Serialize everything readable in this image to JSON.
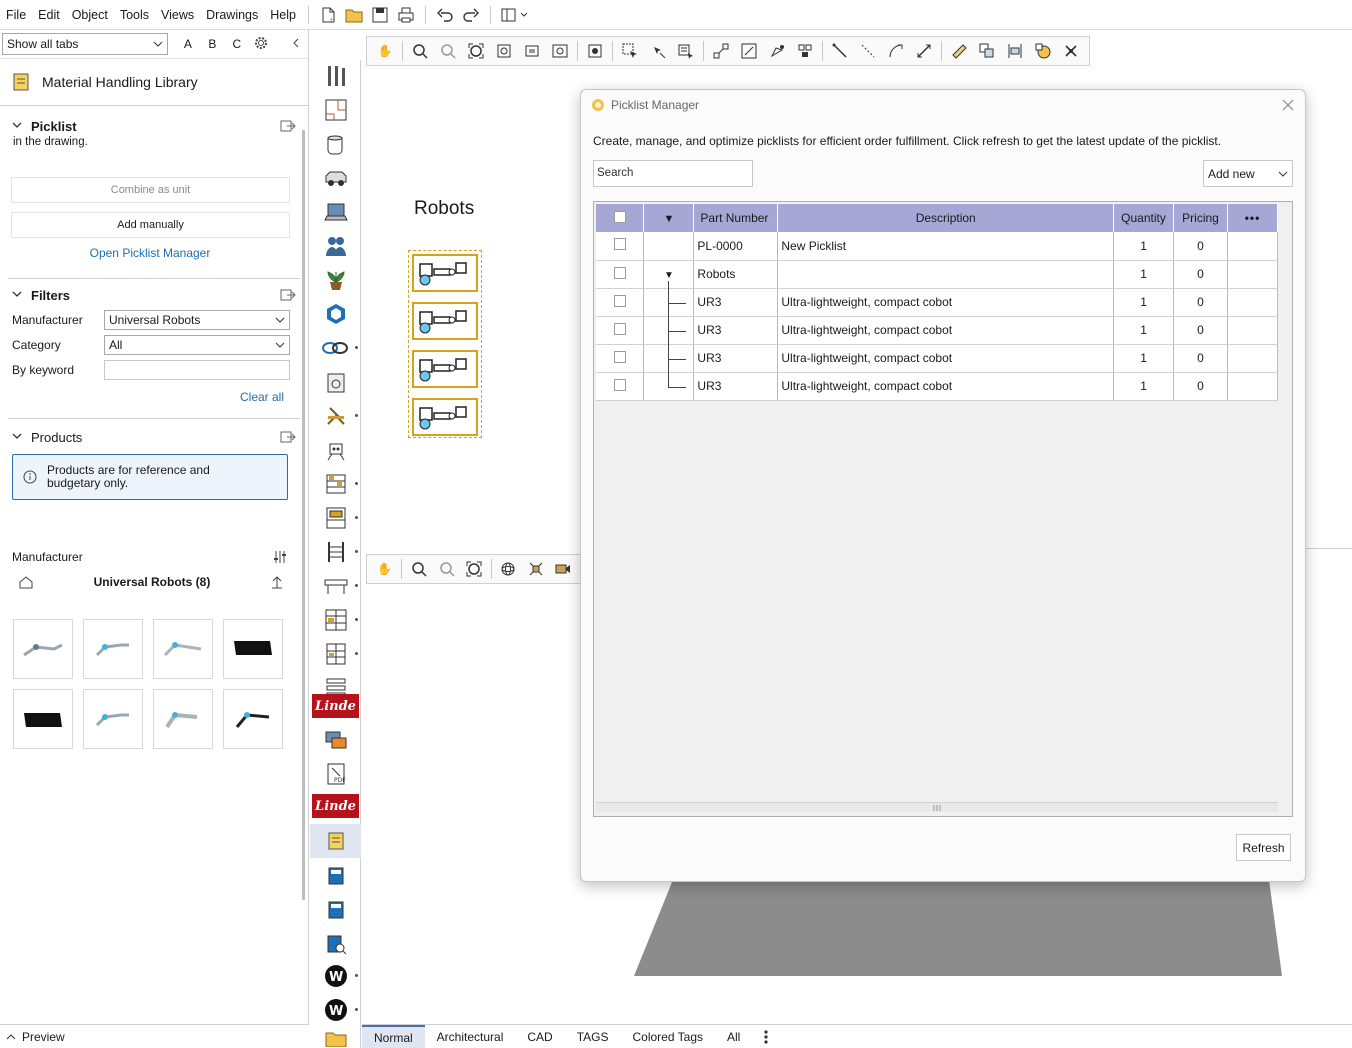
{
  "menu": [
    "File",
    "Edit",
    "Object",
    "Tools",
    "Views",
    "Drawings",
    "Help"
  ],
  "left": {
    "tab_select": "Show all tabs",
    "abc": [
      "A",
      "B",
      "C"
    ],
    "library_title": "Material Handling Library",
    "picklist": {
      "header": "Picklist",
      "note": "in the drawing.",
      "combine": "Combine as unit",
      "add_manual": "Add manually",
      "open_manager": "Open Picklist Manager"
    },
    "filters": {
      "header": "Filters",
      "manufacturer_label": "Manufacturer",
      "manufacturer_value": "Universal Robots",
      "category_label": "Category",
      "category_value": "All",
      "keyword_label": "By keyword",
      "clear": "Clear all"
    },
    "products": {
      "header": "Products",
      "info": "Products are for reference and budgetary only.",
      "manufacturer_label": "Manufacturer",
      "group_title": "Universal Robots (8)"
    },
    "preview": "Preview"
  },
  "canvas": {
    "robots_label": "Robots"
  },
  "strip": {
    "linde": "Linde"
  },
  "bottom_tabs": [
    "Normal",
    "Architectural",
    "CAD",
    "TAGS",
    "Colored Tags",
    "All"
  ],
  "dialog": {
    "title": "Picklist Manager",
    "description": "Create, manage, and optimize picklists for efficient order fulfillment. Click refresh to get the latest update of the picklist.",
    "search_placeholder": "Search",
    "add_new": "Add new",
    "columns": [
      "Part Number",
      "Description",
      "Quantity",
      "Pricing"
    ],
    "rows": [
      {
        "part": "PL-0000",
        "desc": "New Picklist",
        "qty": "1",
        "price": "0"
      },
      {
        "part": "Robots",
        "desc": "",
        "qty": "1",
        "price": "0"
      },
      {
        "part": "UR3",
        "desc": "Ultra-lightweight, compact cobot",
        "qty": "1",
        "price": "0"
      },
      {
        "part": "UR3",
        "desc": "Ultra-lightweight, compact cobot",
        "qty": "1",
        "price": "0"
      },
      {
        "part": "UR3",
        "desc": "Ultra-lightweight, compact cobot",
        "qty": "1",
        "price": "0"
      },
      {
        "part": "UR3",
        "desc": "Ultra-lightweight, compact cobot",
        "qty": "1",
        "price": "0"
      }
    ],
    "refresh": "Refresh"
  },
  "colors": {
    "header_purple": "#a7a7d6",
    "linde_red": "#b5121b",
    "accent_blue": "#1f6fb0"
  }
}
